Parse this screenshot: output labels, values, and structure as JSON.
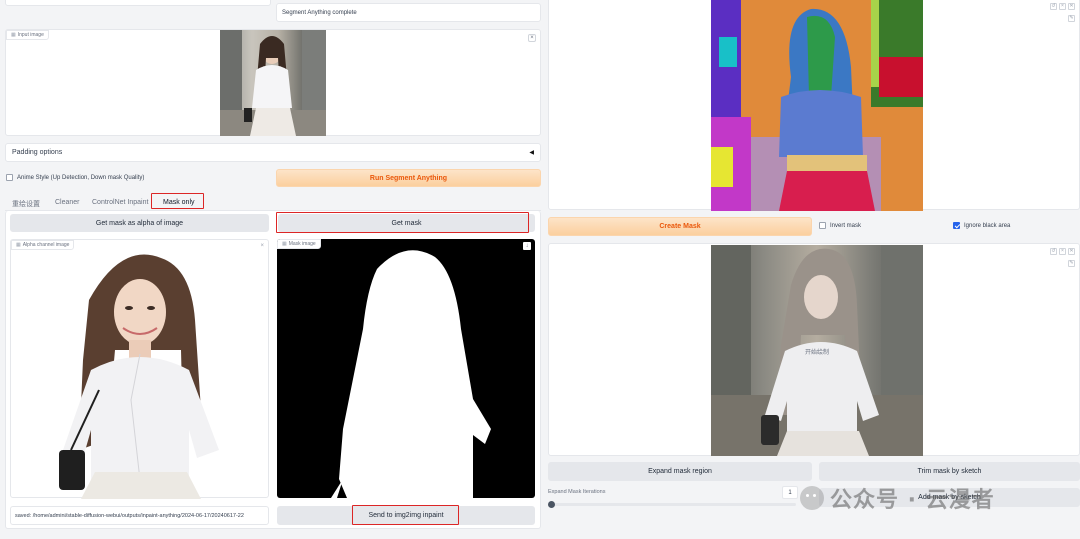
{
  "status_text": "Segment Anything complete",
  "input_image": {
    "label": "Input image"
  },
  "padding_options": {
    "label": "Padding options",
    "toggle_icon": "triangle-left-icon"
  },
  "anime_style": {
    "label": "Anime Style (Up Detection, Down mask Quality)",
    "checked": false
  },
  "run_segment": {
    "label": "Run Segment Anything"
  },
  "tabs": [
    {
      "label": "重绘设置",
      "active": false
    },
    {
      "label": "Cleaner",
      "active": false
    },
    {
      "label": "ControlNet Inpaint",
      "active": false
    },
    {
      "label": "Mask only",
      "active": true
    }
  ],
  "mask_only": {
    "alpha_button": "Get mask as alpha of image",
    "get_mask_button": "Get mask",
    "alpha_image_label": "Alpha channel image",
    "mask_image_label": "Mask image",
    "saved_path": "saved: /home/admini/stable-diffusion-webui/outputs/inpaint-anything/2024-06-17/20240617-22",
    "send_button": "Send to img2img inpaint"
  },
  "right": {
    "create_mask_button": "Create Mask",
    "invert_mask": {
      "label": "Invert mask",
      "checked": false
    },
    "ignore_black": {
      "label": "Ignore black area",
      "checked": true
    },
    "expand_button": "Expand mask region",
    "trim_button": "Trim mask by sketch",
    "add_button": "Add mask by sketch",
    "iterations_label": "Expand Mask Iterations",
    "iterations_value": "1",
    "photo_caption": "开始绘制"
  },
  "watermark": "公众号 · 云漫者",
  "colors": {
    "accent": "#ea580c",
    "highlight": "#dc2626",
    "checkbox": "#2563eb"
  }
}
